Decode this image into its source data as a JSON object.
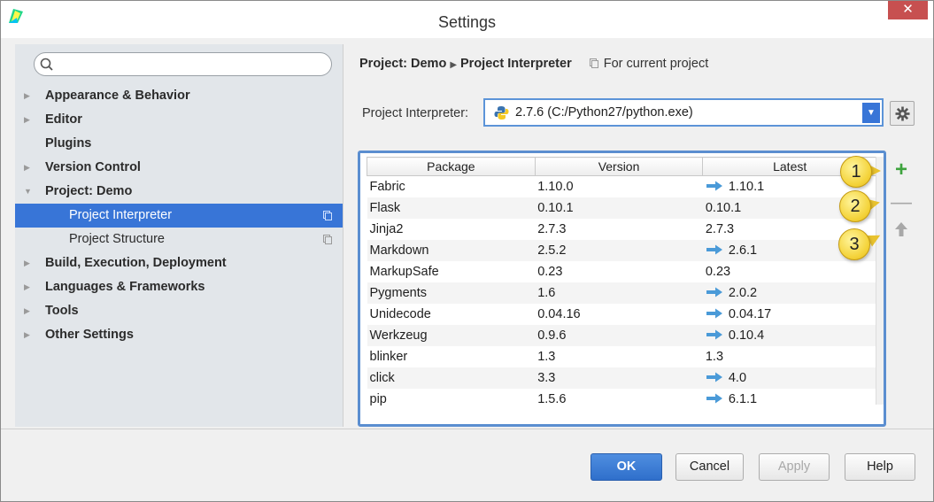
{
  "window": {
    "title": "Settings",
    "close_glyph": "✕",
    "app_icon": "pycharm-icon"
  },
  "sidebar": {
    "search_value": "",
    "items": [
      {
        "label": "Appearance & Behavior",
        "expandable": true
      },
      {
        "label": "Editor",
        "expandable": true
      },
      {
        "label": "Plugins",
        "expandable": false
      },
      {
        "label": "Version Control",
        "expandable": true
      },
      {
        "label": "Project: Demo",
        "expandable": true,
        "expanded": true
      },
      {
        "label": "Project Interpreter",
        "child": true,
        "selected": true
      },
      {
        "label": "Project Structure",
        "child": true
      },
      {
        "label": "Build, Execution, Deployment",
        "expandable": true
      },
      {
        "label": "Languages & Frameworks",
        "expandable": true
      },
      {
        "label": "Tools",
        "expandable": true
      },
      {
        "label": "Other Settings",
        "expandable": true
      }
    ]
  },
  "breadcrumb": {
    "project": "Project: Demo",
    "page": "Project Interpreter",
    "scope": "For current project"
  },
  "interpreter": {
    "label": "Project Interpreter:",
    "value": "2.7.6 (C:/Python27/python.exe)"
  },
  "packages": {
    "headers": [
      "Package",
      "Version",
      "Latest"
    ],
    "rows": [
      {
        "package": "Fabric",
        "version": "1.10.0",
        "latest": "1.10.1",
        "upgrade": true
      },
      {
        "package": "Flask",
        "version": "0.10.1",
        "latest": "0.10.1",
        "upgrade": false
      },
      {
        "package": "Jinja2",
        "version": "2.7.3",
        "latest": "2.7.3",
        "upgrade": false
      },
      {
        "package": "Markdown",
        "version": "2.5.2",
        "latest": "2.6.1",
        "upgrade": true
      },
      {
        "package": "MarkupSafe",
        "version": "0.23",
        "latest": "0.23",
        "upgrade": false
      },
      {
        "package": "Pygments",
        "version": "1.6",
        "latest": "2.0.2",
        "upgrade": true
      },
      {
        "package": "Unidecode",
        "version": "0.04.16",
        "latest": "0.04.17",
        "upgrade": true
      },
      {
        "package": "Werkzeug",
        "version": "0.9.6",
        "latest": "0.10.4",
        "upgrade": true
      },
      {
        "package": "blinker",
        "version": "1.3",
        "latest": "1.3",
        "upgrade": false
      },
      {
        "package": "click",
        "version": "3.3",
        "latest": "4.0",
        "upgrade": true
      },
      {
        "package": "pip",
        "version": "1.5.6",
        "latest": "6.1.1",
        "upgrade": true
      }
    ]
  },
  "tools": {
    "add_glyph": "+",
    "remove_glyph": "—"
  },
  "callouts": [
    "1",
    "2",
    "3"
  ],
  "footer": {
    "ok": "OK",
    "cancel": "Cancel",
    "apply": "Apply",
    "help": "Help"
  },
  "colors": {
    "selection": "#3875d7",
    "highlight_border": "#5b8ed0",
    "add_green": "#3ea33e",
    "upgrade_arrow": "#4a9ad8",
    "callout_yellow": "#f4d33a"
  }
}
